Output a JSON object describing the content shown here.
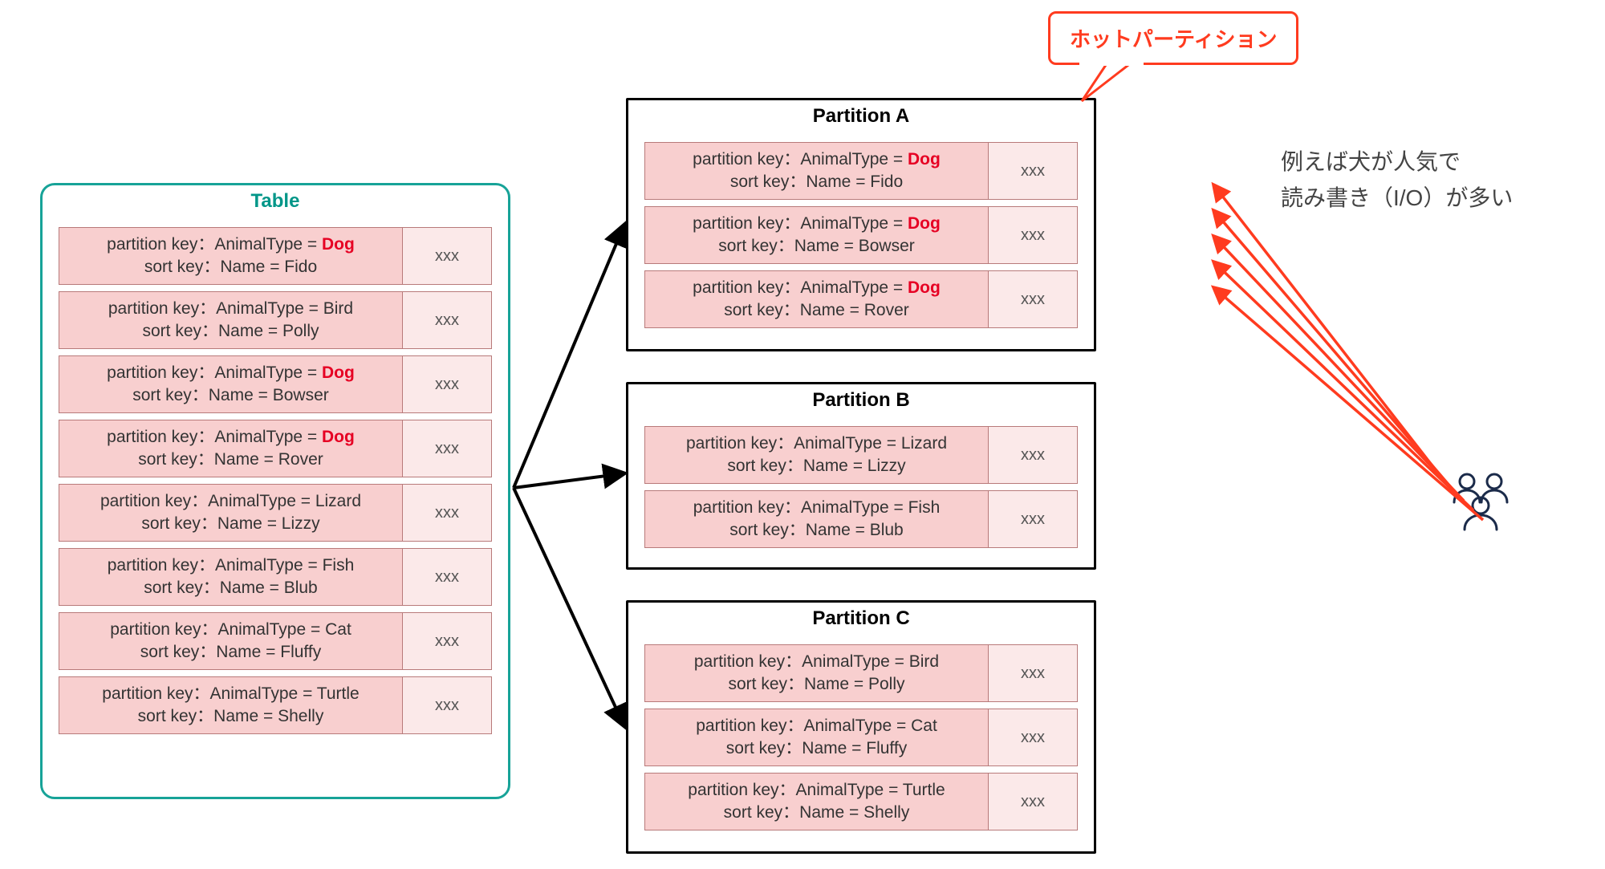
{
  "table": {
    "title": "Table",
    "rows": [
      {
        "pk": "partition key：AnimalType = ",
        "pkval": "Dog",
        "hot": true,
        "sk": "sort key：Name = Fido",
        "val": "xxx"
      },
      {
        "pk": "partition key：AnimalType = ",
        "pkval": "Bird",
        "hot": false,
        "sk": "sort key：Name = Polly",
        "val": "xxx"
      },
      {
        "pk": "partition key：AnimalType = ",
        "pkval": "Dog",
        "hot": true,
        "sk": "sort key：Name = Bowser",
        "val": "xxx"
      },
      {
        "pk": "partition key：AnimalType = ",
        "pkval": "Dog",
        "hot": true,
        "sk": "sort key：Name = Rover",
        "val": "xxx"
      },
      {
        "pk": "partition key：AnimalType = ",
        "pkval": "Lizard",
        "hot": false,
        "sk": "sort key：Name = Lizzy",
        "val": "xxx"
      },
      {
        "pk": "partition key：AnimalType = ",
        "pkval": "Fish",
        "hot": false,
        "sk": "sort key：Name = Blub",
        "val": "xxx"
      },
      {
        "pk": "partition key：AnimalType = ",
        "pkval": "Cat",
        "hot": false,
        "sk": "sort key：Name = Fluffy",
        "val": "xxx"
      },
      {
        "pk": "partition key：AnimalType = ",
        "pkval": "Turtle",
        "hot": false,
        "sk": "sort key：Name = Shelly",
        "val": "xxx"
      }
    ]
  },
  "partitions": [
    {
      "title": "Partition A",
      "rows": [
        {
          "pk": "partition key：AnimalType = ",
          "pkval": "Dog",
          "hot": true,
          "sk": "sort key：Name = Fido",
          "val": "xxx"
        },
        {
          "pk": "partition key：AnimalType = ",
          "pkval": "Dog",
          "hot": true,
          "sk": "sort key：Name = Bowser",
          "val": "xxx"
        },
        {
          "pk": "partition key：AnimalType = ",
          "pkval": "Dog",
          "hot": true,
          "sk": "sort key：Name = Rover",
          "val": "xxx"
        }
      ]
    },
    {
      "title": "Partition B",
      "rows": [
        {
          "pk": "partition key：AnimalType = ",
          "pkval": "Lizard",
          "hot": false,
          "sk": "sort key：Name = Lizzy",
          "val": "xxx"
        },
        {
          "pk": "partition key：AnimalType = ",
          "pkval": "Fish",
          "hot": false,
          "sk": "sort key：Name = Blub",
          "val": "xxx"
        }
      ]
    },
    {
      "title": "Partition C",
      "rows": [
        {
          "pk": "partition key：AnimalType = ",
          "pkval": "Bird",
          "hot": false,
          "sk": "sort key：Name = Polly",
          "val": "xxx"
        },
        {
          "pk": "partition key：AnimalType = ",
          "pkval": "Cat",
          "hot": false,
          "sk": "sort key：Name = Fluffy",
          "val": "xxx"
        },
        {
          "pk": "partition key：AnimalType = ",
          "pkval": "Turtle",
          "hot": false,
          "sk": "sort key：Name = Shelly",
          "val": "xxx"
        }
      ]
    }
  ],
  "callout": "ホットパーティション",
  "sideText": {
    "line1": "例えば犬が人気で",
    "line2": "読み書き（I/O）が多い"
  }
}
